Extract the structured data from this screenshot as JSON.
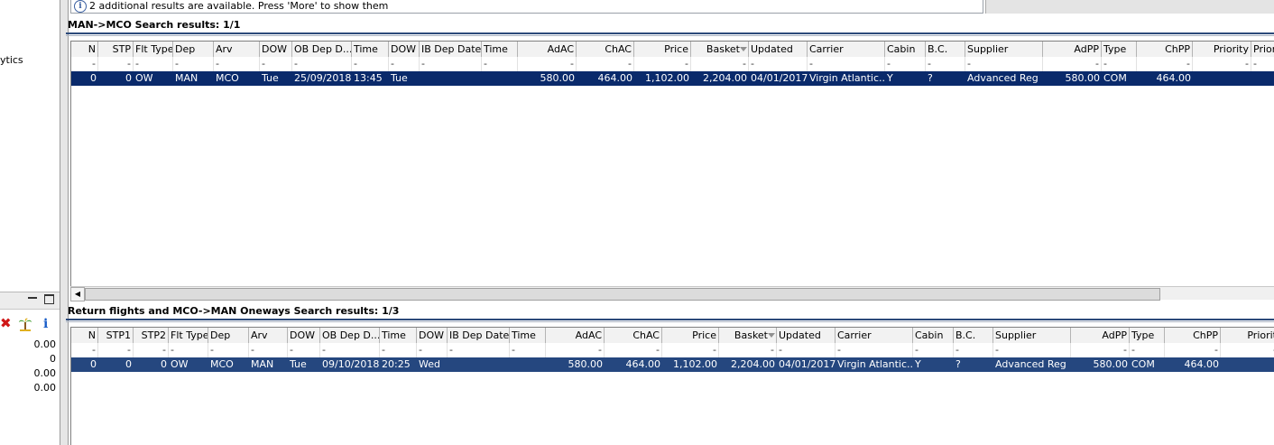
{
  "left_pane": {
    "partial_label": "ytics",
    "values": [
      "0.00",
      "0",
      "0.00",
      "0.00"
    ]
  },
  "info_bar": {
    "icon": "info-icon",
    "message": "2 additional results are available. Press 'More' to show them"
  },
  "outbound": {
    "title": "MAN->MCO Search results: 1/1",
    "columns": [
      "N",
      "STP",
      "Flt Type",
      "Dep",
      "Arv",
      "DOW",
      "OB Dep D...",
      "Time",
      "DOW",
      "IB Dep Date",
      "Time",
      "AdAC",
      "ChAC",
      "Price",
      "Basket",
      "Updated",
      "Carrier",
      "Cabin",
      "B.C.",
      "Supplier",
      "AdPP",
      "Type",
      "ChPP",
      "Priority",
      "Priorit"
    ],
    "filter_row": [
      "-",
      "-",
      "-",
      "-",
      "-",
      "-",
      "-",
      "-",
      "-",
      "-",
      "-",
      "-",
      "-",
      "-",
      "-",
      "-",
      "-",
      "-",
      "-",
      "-",
      "-",
      "-",
      "-",
      "-",
      "-"
    ],
    "rows": [
      [
        "0",
        "0",
        "OW",
        "MAN",
        "MCO",
        "Tue",
        "25/09/2018",
        "13:45",
        "Tue",
        "",
        "",
        "580.00",
        "464.00",
        "1,102.00",
        "2,204.00",
        "04/01/2017",
        "Virgin Atlantic...",
        "Y",
        "?",
        "Advanced Reg",
        "580.00",
        "COM",
        "464.00",
        "",
        ""
      ]
    ]
  },
  "return": {
    "title": "Return flights and MCO->MAN Oneways Search results: 1/3",
    "columns": [
      "N",
      "STP1",
      "STP2",
      "Flt Type",
      "Dep",
      "Arv",
      "DOW",
      "OB Dep D...",
      "Time",
      "DOW",
      "IB Dep Date",
      "Time",
      "AdAC",
      "ChAC",
      "Price",
      "Basket",
      "Updated",
      "Carrier",
      "Cabin",
      "B.C.",
      "Supplier",
      "AdPP",
      "Type",
      "ChPP",
      "Priorit"
    ],
    "filter_row": [
      "-",
      "-",
      "-",
      "-",
      "-",
      "-",
      "-",
      "-",
      "-",
      "-",
      "-",
      "-",
      "-",
      "-",
      "-",
      "-",
      "-",
      "-",
      "-",
      "-",
      "-",
      "-",
      "-",
      "-",
      "-"
    ],
    "rows": [
      [
        "0",
        "0",
        "0",
        "OW",
        "MCO",
        "MAN",
        "Tue",
        "09/10/2018",
        "20:25",
        "Wed",
        "",
        "",
        "580.00",
        "464.00",
        "1,102.00",
        "2,204.00",
        "04/01/2017",
        "Virgin Atlantic...",
        "Y",
        "?",
        "Advanced Reg",
        "580.00",
        "COM",
        "464.00",
        ""
      ]
    ]
  }
}
